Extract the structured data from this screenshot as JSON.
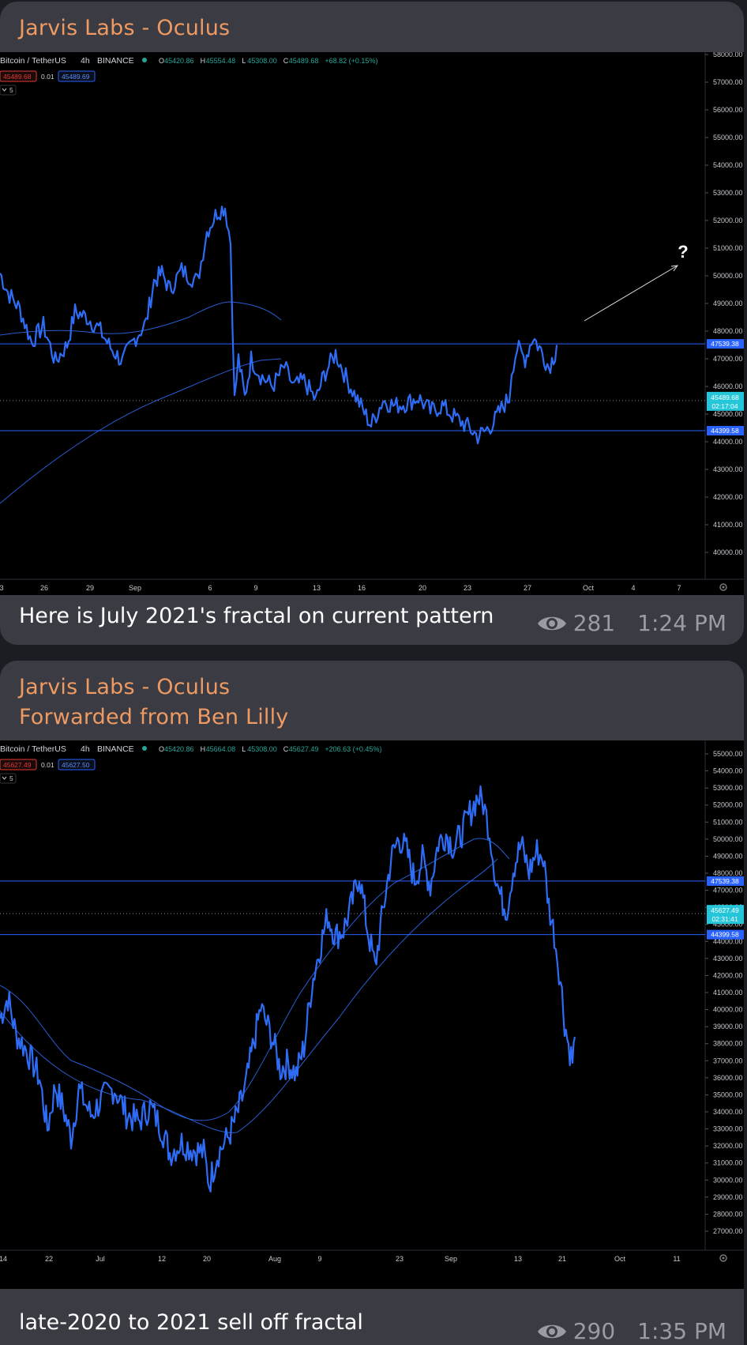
{
  "messages": [
    {
      "sender": "Jarvis Labs - Oculus",
      "forwarded": "",
      "caption": "Here is July 2021's fractal on current pattern",
      "views": "281",
      "time": "1:24 PM",
      "chart": {
        "symbol": "Bitcoin / TetherUS",
        "interval": "4h",
        "exchange": "BINANCE",
        "ohlc": {
          "o_label": "O",
          "o": "45420.86",
          "h_label": "H",
          "h": "45554.48",
          "l_label": "L",
          "l": "45308.00",
          "c_label": "C",
          "c": "45489.68",
          "change": "+68.82 (+0.15%)"
        },
        "bid": "45489.68",
        "spread": "0.01",
        "ask": "45489.69",
        "indicators_count": "5",
        "y_ticks": [
          "58000.00",
          "57000.00",
          "56000.00",
          "55000.00",
          "54000.00",
          "53000.00",
          "52000.00",
          "51000.00",
          "50000.00",
          "49000.00",
          "48000.00",
          "47000.00",
          "46000.00",
          "45000.00",
          "44000.00",
          "43000.00",
          "42000.00",
          "41000.00",
          "40000.00"
        ],
        "x_ticks": [
          "3",
          "26",
          "29",
          "Sep",
          "6",
          "9",
          "13",
          "16",
          "20",
          "23",
          "27",
          "Oct",
          "4",
          "7"
        ],
        "levels": [
          {
            "price": 47539.38,
            "label": "47539.38",
            "style": "solid"
          },
          {
            "price": 44399.58,
            "label": "44399.58",
            "style": "solid"
          }
        ],
        "current": {
          "price": 45489.68,
          "label": "45489.68",
          "countdown": "02:17:04"
        },
        "annotation": "?"
      }
    },
    {
      "sender": "Jarvis Labs - Oculus",
      "forwarded": "Forwarded from Ben Lilly",
      "caption": "late-2020 to 2021 sell off fractal",
      "views": "290",
      "time": "1:35 PM",
      "chart": {
        "symbol": "Bitcoin / TetherUS",
        "interval": "4h",
        "exchange": "BINANCE",
        "ohlc": {
          "o_label": "O",
          "o": "45420.86",
          "h_label": "H",
          "h": "45664.08",
          "l_label": "L",
          "l": "45308.00",
          "c_label": "C",
          "c": "45627.49",
          "change": "+206.63 (+0.45%)"
        },
        "bid": "45627.49",
        "spread": "0.01",
        "ask": "45627.50",
        "indicators_count": "5",
        "y_ticks": [
          "55000.00",
          "54000.00",
          "53000.00",
          "52000.00",
          "51000.00",
          "50000.00",
          "49000.00",
          "48000.00",
          "47000.00",
          "46000.00",
          "45000.00",
          "44000.00",
          "43000.00",
          "42000.00",
          "41000.00",
          "40000.00",
          "39000.00",
          "38000.00",
          "37000.00",
          "36000.00",
          "35000.00",
          "34000.00",
          "33000.00",
          "32000.00",
          "31000.00",
          "30000.00",
          "29000.00",
          "28000.00",
          "27000.00"
        ],
        "x_ticks": [
          "14",
          "22",
          "Jul",
          "12",
          "20",
          "Aug",
          "9",
          "23",
          "Sep",
          "13",
          "21",
          "Oct",
          "11"
        ],
        "levels": [
          {
            "price": 47539.38,
            "label": "47539.38",
            "style": "solid"
          },
          {
            "price": 44399.58,
            "label": "44399.58",
            "style": "solid"
          }
        ],
        "current": {
          "price": 45627.49,
          "label": "45627.49",
          "countdown": "02:31:41"
        },
        "annotation": ""
      }
    }
  ],
  "colors": {
    "sender": "#ee9a62",
    "bubble": "#3a3b43",
    "background": "#1c1d22",
    "candle": "#2f6cf5",
    "level": "#2962ff",
    "price_tag": "#29b6f6"
  },
  "icons": {
    "views": "eye-icon",
    "settings": "gear-icon"
  }
}
